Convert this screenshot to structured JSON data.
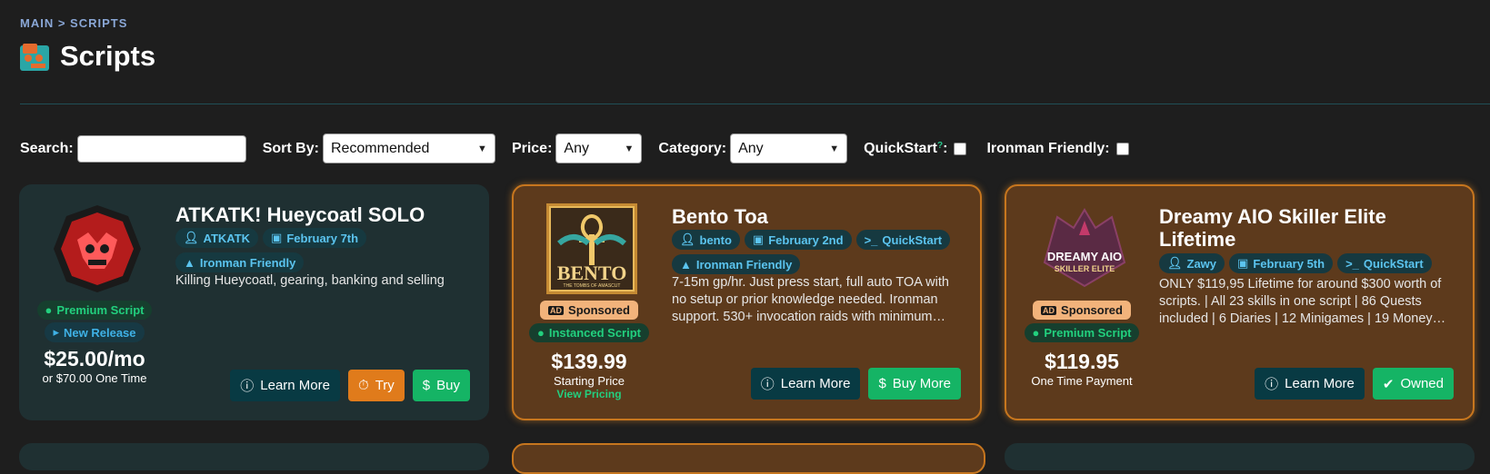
{
  "breadcrumb": "MAIN > SCRIPTS",
  "page_title": "Scripts",
  "filters": {
    "search_label": "Search:",
    "search_value": "",
    "sort_label": "Sort By:",
    "sort_value": "Recommended",
    "price_label": "Price:",
    "price_value": "Any",
    "category_label": "Category:",
    "category_value": "Any",
    "quickstart_label": "QuickStart",
    "quickstart_help": "?",
    "quickstart_colon": ":",
    "ironman_label": "Ironman Friendly:"
  },
  "cards": [
    {
      "name": "ATKATK! Hueycoatl SOLO",
      "author": "ATKATK",
      "date": "February 7th",
      "tags": [
        "Ironman Friendly"
      ],
      "description": "Killing Hueycoatl, gearing, banking and selling",
      "badges": [
        "Premium Script",
        "New Release"
      ],
      "price": "$25.00/mo",
      "price_sub": "or $70.00 One Time",
      "buttons": {
        "learn": "Learn More",
        "try": "Try",
        "buy": "Buy"
      }
    },
    {
      "name": "Bento Toa",
      "author": "bento",
      "date": "February 2nd",
      "quickstart": "QuickStart",
      "tags": [
        "Ironman Friendly"
      ],
      "description": "7-15m gp/hr. Just press start, full auto TOA with no setup or prior knowledge needed. Ironman support. 530+ invocation raids with minimum…",
      "badges": [
        "Sponsored",
        "Instanced Script"
      ],
      "price": "$139.99",
      "price_sub": "Starting Price",
      "view_pricing": "View Pricing",
      "logo_text": "BENTO",
      "logo_sub": "THE TOMBS OF AMASCUT",
      "buttons": {
        "learn": "Learn More",
        "buy": "Buy More"
      }
    },
    {
      "name": "Dreamy AIO Skiller Elite Lifetime",
      "author": "Zawy",
      "date": "February 5th",
      "quickstart": "QuickStart",
      "description": "ONLY $119,95 Lifetime for around $300 worth of scripts. | All 23 skills in one script | 86 Quests included | 6 Diaries | 12 Minigames | 19 Money…",
      "badges": [
        "Sponsored",
        "Premium Script"
      ],
      "price": "$119.95",
      "price_sub": "One Time Payment",
      "logo_text": "DREAMY AIO",
      "logo_sub": "SKILLER ELITE",
      "buttons": {
        "learn": "Learn More",
        "owned": "Owned"
      }
    }
  ],
  "colors": {
    "background": "#1e1e1e",
    "card_dark": "#1f3032",
    "card_sponsored": "#5d3a1c",
    "sponsored_border": "#c7761e",
    "green": "#15b465",
    "orange": "#e07b1b",
    "chip_blue": "#5bc4ef"
  }
}
